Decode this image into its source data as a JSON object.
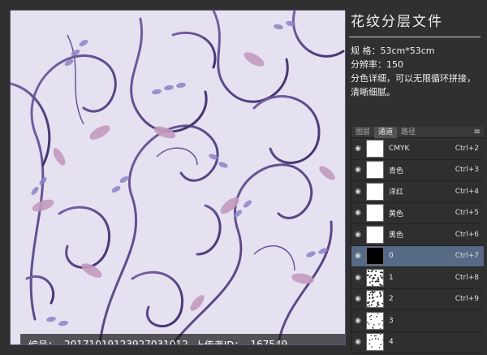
{
  "info": {
    "title": "花纹分层文件",
    "spec": "规 格：53cm*53cm",
    "resolution": "分辨率：150",
    "desc": "分色详细，可以无限循环拼接，清晰细腻。"
  },
  "footer": {
    "id_label": "编号：",
    "id_value": "20171019123927031012",
    "uploader_label": "上传者ID：",
    "uploader_value": "167549"
  },
  "tabs": [
    "图层",
    "通道",
    "路径"
  ],
  "channels": [
    {
      "name": "CMYK",
      "shortcut": "Ctrl+2",
      "thumb": "white",
      "selected": false
    },
    {
      "name": "青色",
      "shortcut": "Ctrl+3",
      "thumb": "white",
      "selected": false
    },
    {
      "name": "洋红",
      "shortcut": "Ctrl+4",
      "thumb": "white",
      "selected": false
    },
    {
      "name": "黄色",
      "shortcut": "Ctrl+5",
      "thumb": "white",
      "selected": false
    },
    {
      "name": "黑色",
      "shortcut": "Ctrl+6",
      "thumb": "white",
      "selected": false
    },
    {
      "name": "0",
      "shortcut": "Ctrl+7",
      "thumb": "black",
      "selected": true
    },
    {
      "name": "1",
      "shortcut": "Ctrl+8",
      "thumb": "speckle",
      "selected": false
    },
    {
      "name": "2",
      "shortcut": "Ctrl+9",
      "thumb": "speckle",
      "selected": false
    },
    {
      "name": "3",
      "shortcut": "",
      "thumb": "speckle-light",
      "selected": false
    },
    {
      "name": "4",
      "shortcut": "",
      "thumb": "speckle-light",
      "selected": false
    }
  ],
  "colors": {
    "bg": "#e6e1f0",
    "vine": "#5c4a8a",
    "leaf": "#8f86c8",
    "bud": "#b58ab0",
    "selected": "#566a86"
  }
}
